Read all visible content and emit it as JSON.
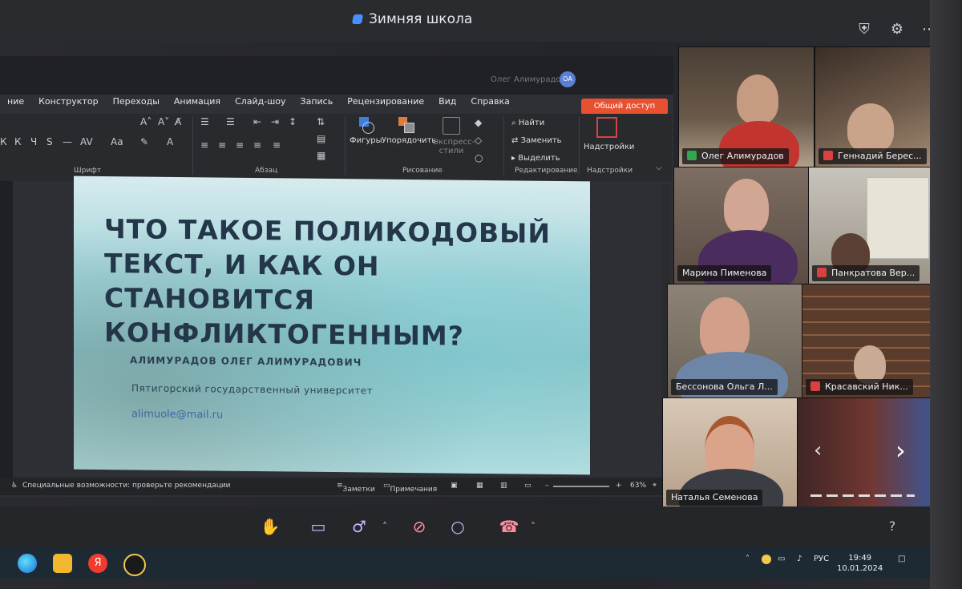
{
  "window": {
    "title": "Зимняя школа"
  },
  "ppt": {
    "user_name": "Олег Алимурадов",
    "avatar_initials": "ОА",
    "menu": [
      "ние",
      "Конструктор",
      "Переходы",
      "Анимация",
      "Слайд-шоу",
      "Запись",
      "Рецензирование",
      "Вид",
      "Справка"
    ],
    "share_label": "Общий доступ",
    "ribbon": {
      "font_group": "Шрифт",
      "paragraph_group": "Абзац",
      "drawing_group": "Рисование",
      "editing_group": "Редактирование",
      "addins_group": "Надстройки",
      "shapes": "Фигуры",
      "arrange": "Упорядочить",
      "express_styles": "Экспресс-стили",
      "find": "Найти",
      "replace": "Заменить",
      "select": "Выделить",
      "addins": "Надстройки"
    },
    "slide": {
      "title": "ЧТО ТАКОЕ ПОЛИКОДОВЫЙ ТЕКСТ, И КАК ОН СТАНОВИТСЯ КОНФЛИКТОГЕННЫМ?",
      "author": "АЛИМУРАДОВ ОЛЕГ АЛИМУРАДОВИЧ",
      "university": "Пятигорский государственный университет",
      "email": "alimuole@mail.ru"
    },
    "status": {
      "accessibility": "Специальные возможности: проверьте рекомендации",
      "notes": "Заметки",
      "comments": "Примечания",
      "zoom": "63%"
    }
  },
  "participants": [
    {
      "name": "Олег Алимурадов",
      "muted": false
    },
    {
      "name": "Геннадий Берес...",
      "muted": true
    },
    {
      "name": "Марина Пименова",
      "muted": false
    },
    {
      "name": "Панкратова Вер...",
      "muted": true
    },
    {
      "name": "Бессонова Ольга Л...",
      "muted": false
    },
    {
      "name": "Красавский Ник...",
      "muted": true
    },
    {
      "name": "Наталья Семенова",
      "muted": false
    }
  ],
  "controls": {
    "help": "?"
  },
  "taskbar": {
    "lang": "РУС",
    "time": "19:49",
    "date": "10.01.2024"
  }
}
